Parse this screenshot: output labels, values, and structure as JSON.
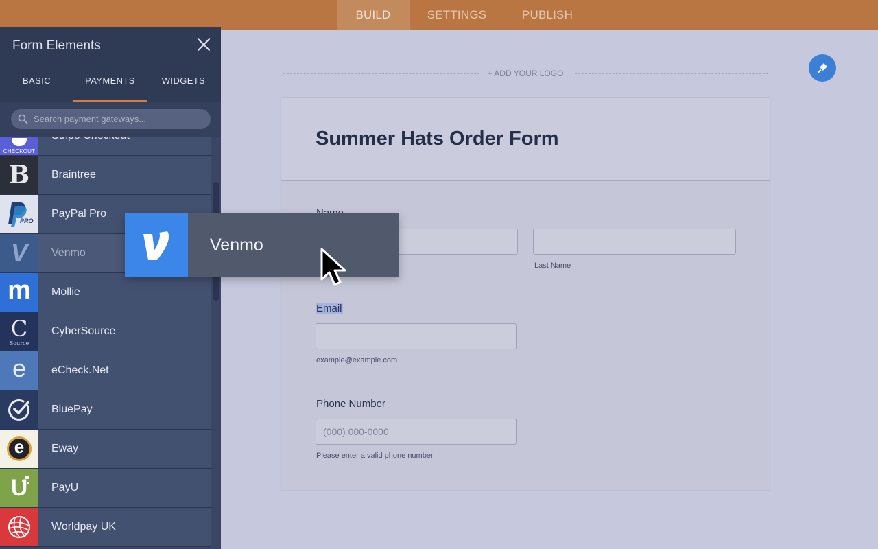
{
  "topbar": {
    "tabs": [
      "BUILD",
      "SETTINGS",
      "PUBLISH"
    ],
    "active": "BUILD"
  },
  "sidebar": {
    "title": "Form Elements",
    "tabs": [
      "BASIC",
      "PAYMENTS",
      "WIDGETS"
    ],
    "active_tab": "PAYMENTS",
    "search_placeholder": "Search payment gateways...",
    "items": [
      {
        "label": "Stripe Checkout",
        "icon": "stripe-checkout-logo",
        "logo_text": "CHECKOUT"
      },
      {
        "label": "Braintree",
        "icon": "braintree-logo",
        "logo_text": "B"
      },
      {
        "label": "PayPal Pro",
        "icon": "paypal-pro-logo",
        "logo_text": "PRO"
      },
      {
        "label": "Venmo",
        "icon": "venmo-logo",
        "logo_text": "V"
      },
      {
        "label": "Mollie",
        "icon": "mollie-logo",
        "logo_text": "m"
      },
      {
        "label": "CyberSource",
        "icon": "cybersource-logo",
        "logo_text": "C",
        "logo_sub": "Source"
      },
      {
        "label": "eCheck.Net",
        "icon": "echeck-logo",
        "logo_text": "e"
      },
      {
        "label": "BluePay",
        "icon": "bluepay-logo"
      },
      {
        "label": "Eway",
        "icon": "eway-logo",
        "logo_text": "e"
      },
      {
        "label": "PayU",
        "icon": "payu-logo",
        "logo_text": "U"
      },
      {
        "label": "Worldpay UK",
        "icon": "worldpay-logo"
      }
    ],
    "colors": {
      "stripe": "#5a5fd6",
      "braintree": "#2b2f3a",
      "paypal": "#dfe3ee",
      "venmo": "#3c5a8a",
      "mollie": "#2f6fd8",
      "cybersource": "#23335c",
      "echeck": "#4f78b8",
      "bluepay": "#2a3a60",
      "eway": "#f4f1e6",
      "payu": "#7ea348",
      "worldpay": "#d9393c"
    }
  },
  "canvas": {
    "add_logo": "+ ADD YOUR LOGO",
    "form": {
      "title": "Summer Hats Order Form",
      "name_label": "Name",
      "last_name_sub": "Last Name",
      "email_label": "Email",
      "email_sub": "example@example.com",
      "phone_label": "Phone Number",
      "phone_placeholder": "(000) 000-0000",
      "phone_sub": "Please enter a valid phone number."
    }
  },
  "drag_item": {
    "label": "Venmo",
    "icon": "venmo-logo",
    "logo_text": "V"
  }
}
